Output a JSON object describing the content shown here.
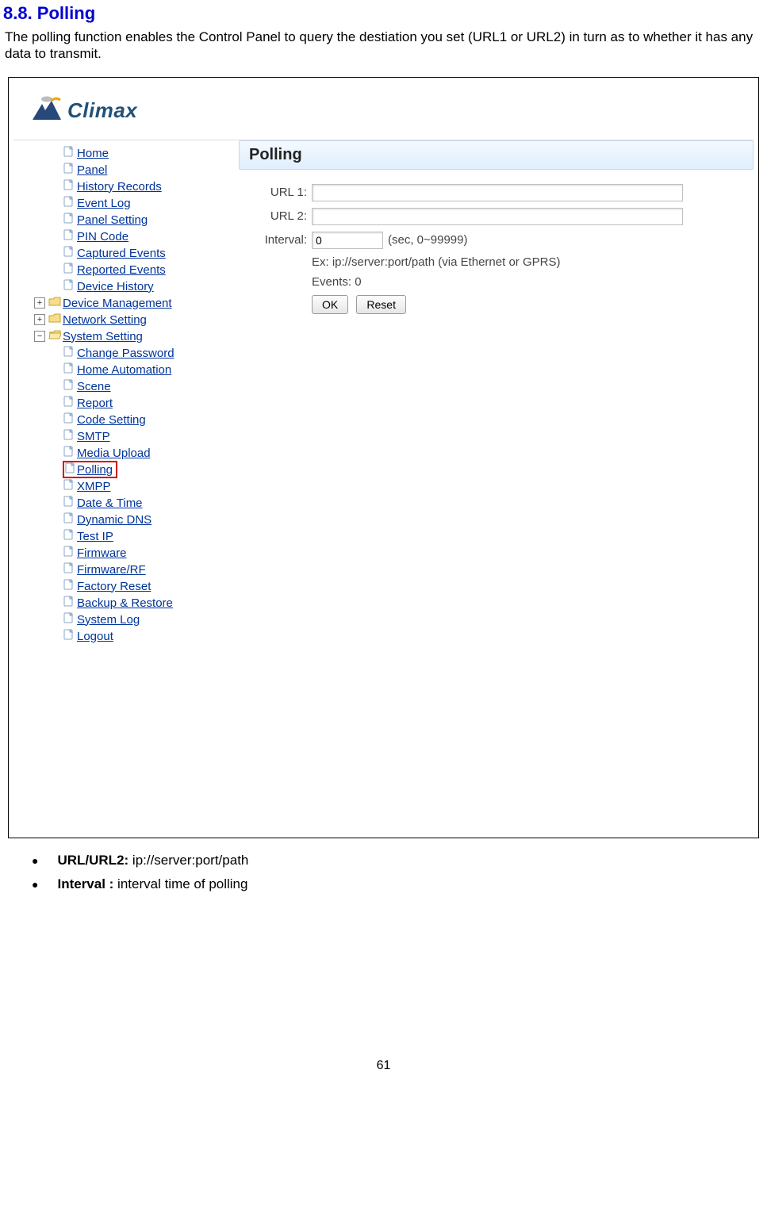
{
  "doc": {
    "heading": "8.8. Polling",
    "intro": "The polling function enables the Control Panel to query the destiation you set (URL1 or URL2) in turn as to whether it has any data to transmit.",
    "bullets": [
      {
        "bold": "URL/URL2:",
        "rest": " ip://server:port/path"
      },
      {
        "bold": "Interval :",
        "rest": " interval time of polling"
      }
    ],
    "page_number": "61"
  },
  "app": {
    "logo_text": "Climax",
    "panel_title": "Polling",
    "tree": {
      "top": [
        "Home",
        "Panel",
        "History Records",
        "Event Log",
        "Panel Setting",
        "PIN Code",
        "Captured Events",
        "Reported Events",
        "Device History"
      ],
      "folders_collapsed": [
        "Device Management",
        "Network Setting"
      ],
      "folder_expanded": "System Setting",
      "children": [
        "Change Password",
        "Home Automation",
        "Scene",
        "Report",
        "Code Setting",
        "SMTP",
        "Media Upload",
        "Polling",
        "XMPP",
        "Date & Time",
        "Dynamic DNS",
        "Test IP",
        "Firmware",
        "Firmware/RF",
        "Factory Reset",
        "Backup & Restore",
        "System Log"
      ],
      "highlighted_child": "Polling",
      "logout": "Logout"
    },
    "form": {
      "url1_label": "URL 1:",
      "url2_label": "URL 2:",
      "interval_label": "Interval:",
      "url1_value": "",
      "url2_value": "",
      "interval_value": "0",
      "interval_unit": "(sec, 0~99999)",
      "hint": "Ex: ip://server:port/path (via Ethernet or GPRS)",
      "events": "Events: 0",
      "ok_label": "OK",
      "reset_label": "Reset"
    }
  }
}
